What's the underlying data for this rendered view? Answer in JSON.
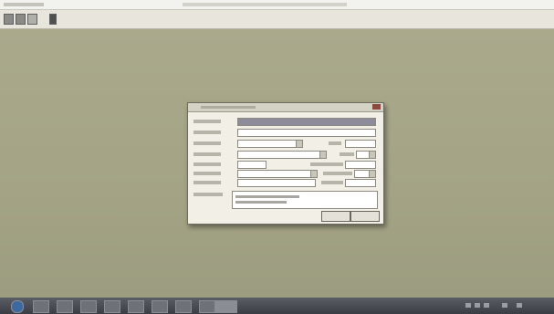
{
  "window": {
    "title": ""
  },
  "toolbar": {
    "icons": [
      "new-icon",
      "open-icon",
      "save-icon",
      "settings-icon"
    ]
  },
  "dialog": {
    "title": "",
    "rows": [
      {
        "label": "",
        "value": "",
        "highlighted": true
      },
      {
        "label": "",
        "value": ""
      },
      {
        "label": "",
        "value": "",
        "sub_label": "",
        "sub_value": ""
      },
      {
        "label": "",
        "value": "",
        "sub_label": "",
        "sub_value": ""
      },
      {
        "label": "",
        "value": "",
        "sub_label": "",
        "sub_value": ""
      },
      {
        "label": "",
        "value": "",
        "sub_label": "",
        "sub_value": ""
      },
      {
        "label": "",
        "value": "",
        "sub_label": "",
        "sub_value": ""
      }
    ],
    "notes_label": "",
    "notes_lines": [
      "",
      ""
    ],
    "ok_label": "",
    "cancel_label": ""
  },
  "taskbar": {
    "apps": [
      "ie-icon",
      "folder-icon",
      "media-icon",
      "app-icon",
      "app-icon",
      "app-icon",
      "app-icon",
      "app-icon",
      "app-icon"
    ],
    "clock_time": "",
    "clock_date": ""
  }
}
